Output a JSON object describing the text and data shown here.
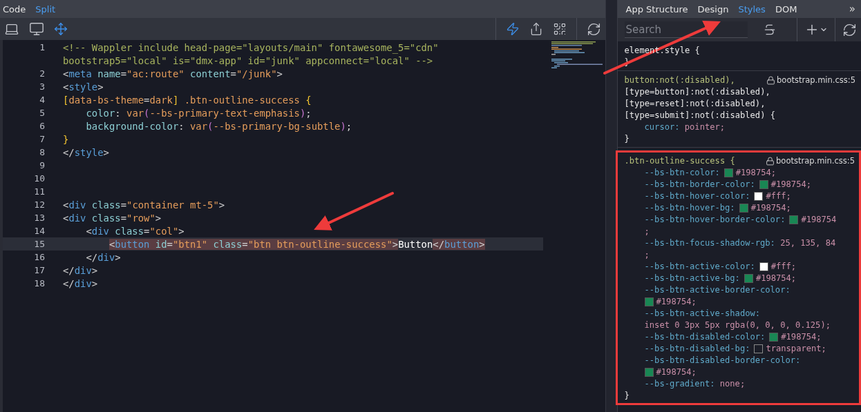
{
  "editor_tabs": [
    {
      "label": "Code",
      "selected": false
    },
    {
      "label": "Split",
      "selected": true
    }
  ],
  "code_lines": [
    {
      "number": "1",
      "selected": false,
      "tokens": [
        {
          "kind": "comment",
          "text": "<!-- Wappler include head-page=\"layouts/main\" fontawesome_5=\"cdn\""
        }
      ]
    },
    {
      "selected": false,
      "tokens": [
        {
          "kind": "comment",
          "text": "bootstrap5=\"local\" is=\"dmx-app\" id=\"junk\" appconnect=\"local\" -->"
        }
      ]
    },
    {
      "number": "2",
      "selected": false,
      "tokens": [
        {
          "kind": "punct",
          "text": "<"
        },
        {
          "kind": "tag",
          "text": "meta"
        },
        {
          "kind": "attr",
          "text": " name"
        },
        {
          "kind": "punct",
          "text": "="
        },
        {
          "kind": "string",
          "text": "\"ac:route\""
        },
        {
          "kind": "attr",
          "text": " content"
        },
        {
          "kind": "punct",
          "text": "="
        },
        {
          "kind": "string",
          "text": "\"/junk\""
        },
        {
          "kind": "punct",
          "text": ">"
        }
      ]
    },
    {
      "number": "3",
      "selected": false,
      "tokens": [
        {
          "kind": "punct",
          "text": "<"
        },
        {
          "kind": "tag",
          "text": "style"
        },
        {
          "kind": "punct",
          "text": ">"
        }
      ]
    },
    {
      "number": "4",
      "selected": false,
      "tokens": [
        {
          "kind": "bracket",
          "text": "["
        },
        {
          "kind": "selector",
          "text": "data-bs-theme"
        },
        {
          "kind": "punct",
          "text": "="
        },
        {
          "kind": "selector",
          "text": "dark"
        },
        {
          "kind": "bracket",
          "text": "]"
        },
        {
          "kind": "selector",
          "text": " .btn-outline-success "
        },
        {
          "kind": "bracket",
          "text": "{"
        }
      ]
    },
    {
      "number": "5",
      "selected": false,
      "tokens": [
        {
          "kind": "property",
          "text": "    color"
        },
        {
          "kind": "punct",
          "text": ": "
        },
        {
          "kind": "func",
          "text": "var"
        },
        {
          "kind": "paren",
          "text": "("
        },
        {
          "kind": "selector",
          "text": "--bs-primary-text-emphasis"
        },
        {
          "kind": "paren",
          "text": ")"
        },
        {
          "kind": "punct",
          "text": ";"
        }
      ]
    },
    {
      "number": "6",
      "selected": false,
      "tokens": [
        {
          "kind": "property",
          "text": "    background-color"
        },
        {
          "kind": "punct",
          "text": ": "
        },
        {
          "kind": "func",
          "text": "var"
        },
        {
          "kind": "paren",
          "text": "("
        },
        {
          "kind": "selector",
          "text": "--bs-primary-bg-subtle"
        },
        {
          "kind": "paren",
          "text": ")"
        },
        {
          "kind": "punct",
          "text": ";"
        }
      ]
    },
    {
      "number": "7",
      "selected": false,
      "tokens": [
        {
          "kind": "bracket",
          "text": "}"
        }
      ]
    },
    {
      "number": "8",
      "selected": false,
      "tokens": [
        {
          "kind": "punct",
          "text": "</"
        },
        {
          "kind": "tag",
          "text": "style"
        },
        {
          "kind": "punct",
          "text": ">"
        }
      ]
    },
    {
      "number": "9",
      "selected": false
    },
    {
      "number": "10",
      "selected": false
    },
    {
      "number": "11",
      "selected": false
    },
    {
      "number": "12",
      "selected": false,
      "tokens": [
        {
          "kind": "punct",
          "text": "<"
        },
        {
          "kind": "tag",
          "text": "div"
        },
        {
          "kind": "attr",
          "text": " class"
        },
        {
          "kind": "punct",
          "text": "="
        },
        {
          "kind": "string",
          "text": "\"container mt-5\""
        },
        {
          "kind": "punct",
          "text": ">"
        }
      ]
    },
    {
      "number": "13",
      "selected": false,
      "tokens": [
        {
          "kind": "punct",
          "text": "<"
        },
        {
          "kind": "tag",
          "text": "div"
        },
        {
          "kind": "attr",
          "text": " class"
        },
        {
          "kind": "punct",
          "text": "="
        },
        {
          "kind": "string",
          "text": "\"row\""
        },
        {
          "kind": "punct",
          "text": ">"
        }
      ]
    },
    {
      "number": "14",
      "selected": false,
      "tokens": [
        {
          "kind": "punct",
          "text": "    <"
        },
        {
          "kind": "tag",
          "text": "div"
        },
        {
          "kind": "attr",
          "text": " class"
        },
        {
          "kind": "punct",
          "text": "="
        },
        {
          "kind": "string",
          "text": "\"col\""
        },
        {
          "kind": "punct",
          "text": ">"
        }
      ]
    },
    {
      "number": "15",
      "selected": true,
      "tokens": [
        {
          "kind": "punct",
          "text": "        <"
        },
        {
          "kind": "tag",
          "text": "button"
        },
        {
          "kind": "attr",
          "text": " id"
        },
        {
          "kind": "punct",
          "text": "="
        },
        {
          "kind": "string",
          "text": "\"btn1\""
        },
        {
          "kind": "attr",
          "text": " class"
        },
        {
          "kind": "punct",
          "text": "="
        },
        {
          "kind": "string",
          "text": "\"btn btn-outline-success\""
        },
        {
          "kind": "punct",
          "text": ">"
        },
        {
          "kind": "text",
          "text": "Button"
        },
        {
          "kind": "punct",
          "text": "</"
        },
        {
          "kind": "tag",
          "text": "button"
        },
        {
          "kind": "punct",
          "text": ">"
        }
      ]
    },
    {
      "number": "16",
      "selected": false,
      "tokens": [
        {
          "kind": "punct",
          "text": "    </"
        },
        {
          "kind": "tag",
          "text": "div"
        },
        {
          "kind": "punct",
          "text": ">"
        }
      ]
    },
    {
      "number": "17",
      "selected": false,
      "tokens": [
        {
          "kind": "punct",
          "text": "</"
        },
        {
          "kind": "tag",
          "text": "div"
        },
        {
          "kind": "punct",
          "text": ">"
        }
      ]
    },
    {
      "number": "18",
      "selected": false,
      "tokens": [
        {
          "kind": "punct",
          "text": "</"
        },
        {
          "kind": "tag",
          "text": "div"
        },
        {
          "kind": "punct",
          "text": ">"
        }
      ]
    }
  ],
  "panel_tabs": [
    {
      "label": "App Structure",
      "selected": false
    },
    {
      "label": "Design",
      "selected": false
    },
    {
      "label": "Styles",
      "selected": true
    },
    {
      "label": "DOM",
      "selected": false
    }
  ],
  "more_tabs": "»",
  "search": {
    "placeholder": "Search"
  },
  "rules": [
    {
      "annotated": false,
      "selectors": [
        {
          "text": "element.style {",
          "matched": false
        }
      ],
      "close": "}"
    },
    {
      "annotated": false,
      "source": "bootstrap.min.css:5",
      "selectors": [
        {
          "text": "button:not(:disabled),",
          "matched": true
        },
        {
          "text": "[type=button]:not(:disabled),",
          "matched": false
        },
        {
          "text": "[type=reset]:not(:disabled),",
          "matched": false
        },
        {
          "text": "[type=submit]:not(:disabled) {",
          "matched": false
        }
      ],
      "declarations": [
        {
          "kind": "inline",
          "property": "cursor:",
          "value": "pointer;"
        }
      ],
      "close": "}"
    },
    {
      "annotated": true,
      "source": "bootstrap.min.css:5",
      "selectors": [
        {
          "text": ".btn-outline-success {",
          "matched": true
        }
      ],
      "declarations": [
        {
          "kind": "inline",
          "property": "--bs-btn-color:",
          "color": "#198754",
          "value": "#198754;"
        },
        {
          "kind": "inline",
          "property": "--bs-btn-border-color:",
          "color": "#198754",
          "value": "#198754;"
        },
        {
          "kind": "inline",
          "property": "--bs-btn-hover-color:",
          "color": "#ffffff",
          "value": "#fff;"
        },
        {
          "kind": "inline",
          "property": "--bs-btn-hover-bg:",
          "color": "#198754",
          "value": "#198754;"
        },
        {
          "kind": "tail",
          "property": "--bs-btn-hover-border-color:",
          "color": "#198754",
          "value": "#198754",
          "tail": ";"
        },
        {
          "kind": "tail",
          "property": "--bs-btn-focus-shadow-rgb:",
          "value": "25, 135, 84",
          "tail": ";"
        },
        {
          "kind": "inline",
          "property": "--bs-btn-active-color:",
          "color": "#ffffff",
          "value": "#fff;"
        },
        {
          "kind": "inline",
          "property": "--bs-btn-active-bg:",
          "color": "#198754",
          "value": "#198754;"
        },
        {
          "kind": "wrapped",
          "property": "--bs-btn-active-border-color:",
          "color": "#198754",
          "value": "#198754;"
        },
        {
          "kind": "wrapped",
          "property": "--bs-btn-active-shadow:",
          "value": "inset 0 3px 5px rgba(0, 0, 0, 0.125);"
        },
        {
          "kind": "inline",
          "property": "--bs-btn-disabled-color:",
          "color": "#198754",
          "value": "#198754;"
        },
        {
          "kind": "inline",
          "property": "--bs-btn-disabled-bg:",
          "empty_swatch": true,
          "value": "transparent;"
        },
        {
          "kind": "wrapped",
          "property": "--bs-btn-disabled-border-color:",
          "color": "#198754",
          "value": "#198754;"
        },
        {
          "kind": "inline",
          "property": "--bs-gradient:",
          "value": "none;"
        }
      ],
      "close": "}"
    }
  ]
}
